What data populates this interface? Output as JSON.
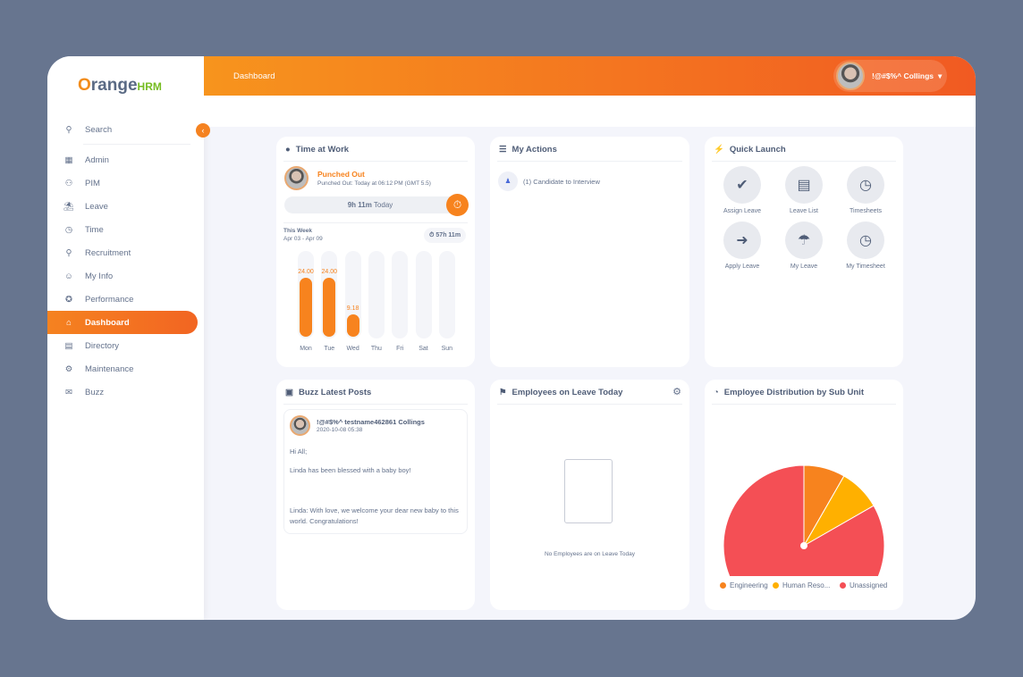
{
  "brand": {
    "logo_text": "OrangeHRM"
  },
  "header": {
    "title": "Dashboard",
    "user_name": "!@#$%^ Collings"
  },
  "sidebar": {
    "search": "Search",
    "items": [
      {
        "label": "Admin",
        "icon": "admin-icon"
      },
      {
        "label": "PIM",
        "icon": "pim-icon"
      },
      {
        "label": "Leave",
        "icon": "leave-icon"
      },
      {
        "label": "Time",
        "icon": "time-icon"
      },
      {
        "label": "Recruitment",
        "icon": "recruitment-icon"
      },
      {
        "label": "My Info",
        "icon": "my-info-icon"
      },
      {
        "label": "Performance",
        "icon": "performance-icon"
      },
      {
        "label": "Dashboard",
        "icon": "home-icon",
        "active": true
      },
      {
        "label": "Directory",
        "icon": "directory-icon"
      },
      {
        "label": "Maintenance",
        "icon": "maintenance-icon"
      },
      {
        "label": "Buzz",
        "icon": "buzz-icon"
      }
    ]
  },
  "time_at_work": {
    "title": "Time at Work",
    "status": "Punched Out",
    "detail": "Punched Out: Today at 06:12 PM (GMT 5.5)",
    "today_hours": "9h 11m",
    "today_label": "Today",
    "week_label": "This Week",
    "week_range": "Apr 03 - Apr 09",
    "week_total": "57h 11m",
    "chart_data": {
      "type": "bar",
      "categories": [
        "Mon",
        "Tue",
        "Wed",
        "Thu",
        "Fri",
        "Sat",
        "Sun"
      ],
      "values": [
        24.0,
        24.0,
        9.18,
        0,
        0,
        0,
        0
      ],
      "labels": [
        "24.00",
        "24.00",
        "9.18",
        "",
        "",
        "",
        ""
      ],
      "ylim": [
        0,
        24
      ]
    }
  },
  "my_actions": {
    "title": "My Actions",
    "items": [
      "(1) Candidate to Interview"
    ]
  },
  "quick_launch": {
    "title": "Quick Launch",
    "items": [
      "Assign Leave",
      "Leave List",
      "Timesheets",
      "Apply Leave",
      "My Leave",
      "My Timesheet"
    ]
  },
  "buzz": {
    "title": "Buzz Latest Posts",
    "author": "!@#$%^ testname462861 Collings",
    "date": "2020-10-08 05:38",
    "lines": [
      "Hi All;",
      "Linda has been blessed with a baby boy!",
      "Linda: With love, we welcome your dear new baby to this world. Congratulations!"
    ]
  },
  "leave_today": {
    "title": "Employees on Leave Today",
    "empty": "No Employees are on Leave Today"
  },
  "distribution": {
    "title": "Employee Distribution by Sub Unit",
    "chart_data": {
      "type": "pie",
      "labels": [
        "Engineering",
        "Human Reso...",
        "Unassigned"
      ],
      "values": [
        8.3,
        8.4,
        83.3
      ],
      "colors": [
        "#f7831e",
        "#ffb000",
        "#f44f55"
      ],
      "data_labels": [
        "",
        "",
        "83.3%"
      ],
      "legend": "bottom"
    }
  },
  "colors": {
    "accent": "#f58220"
  }
}
